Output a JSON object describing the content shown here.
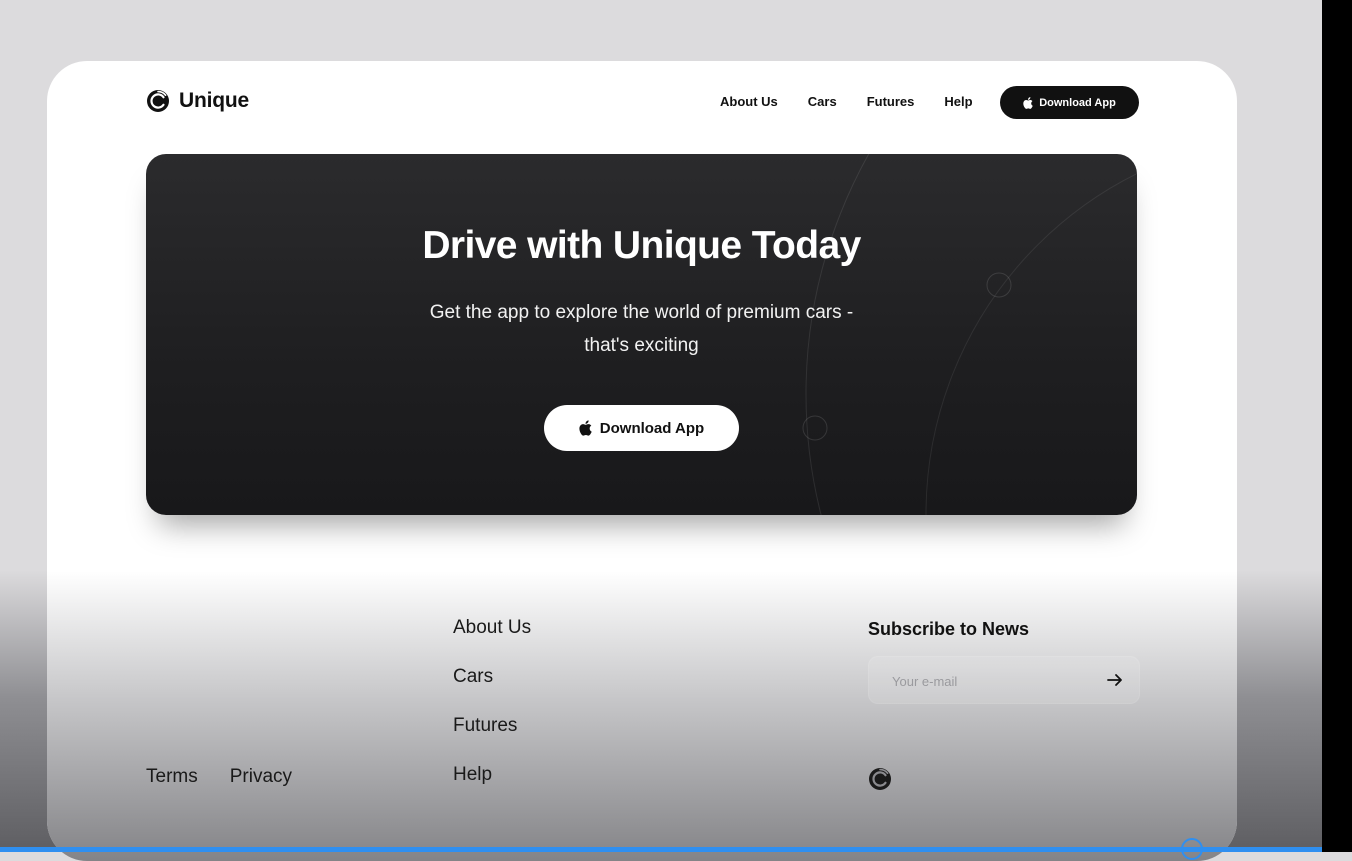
{
  "brand": {
    "name": "Unique"
  },
  "nav": {
    "links": [
      {
        "label": "About Us"
      },
      {
        "label": "Cars"
      },
      {
        "label": "Futures"
      },
      {
        "label": "Help"
      }
    ],
    "download_label": "Download App"
  },
  "hero": {
    "title": "Drive with Unique Today",
    "subtitle": "Get the app to explore the world of premium cars - that's exciting",
    "download_label": "Download App"
  },
  "footer": {
    "links": [
      {
        "label": "About Us"
      },
      {
        "label": "Cars"
      },
      {
        "label": "Futures"
      },
      {
        "label": "Help"
      }
    ],
    "legal": [
      {
        "label": "Terms"
      },
      {
        "label": "Privacy"
      }
    ],
    "subscribe": {
      "title": "Subscribe to News",
      "placeholder": "Your e-mail"
    }
  },
  "icons": {
    "logo": "logo-icon",
    "apple": "apple-icon",
    "arrow": "arrow-right-icon"
  },
  "colors": {
    "accent_dark": "#111111",
    "hero_bg": "#1e1e20",
    "scroll_accent": "#2f8ff0"
  }
}
